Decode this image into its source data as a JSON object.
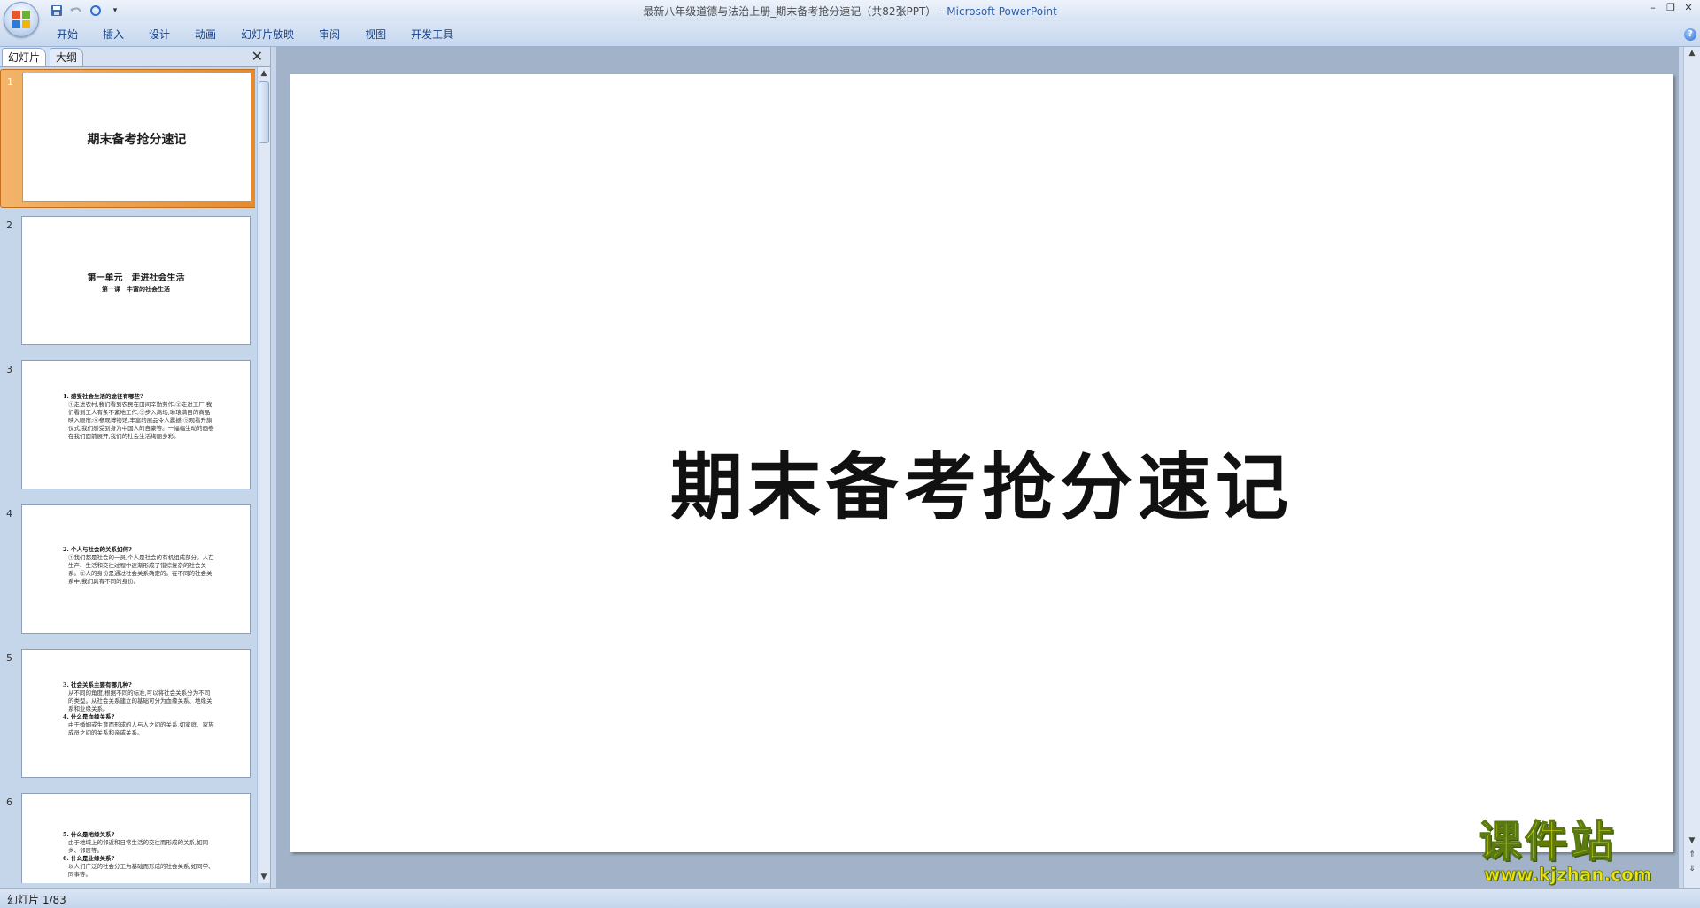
{
  "window": {
    "title": "最新八年级道德与法治上册_期末备考抢分速记（共82张PPT）",
    "app_name": "Microsoft PowerPoint",
    "controls": [
      "–",
      "❐",
      "✕"
    ]
  },
  "quick_access": {
    "save": "save-icon",
    "undo": "undo-icon",
    "redo": "redo-icon",
    "customize": "▾"
  },
  "ribbon": {
    "tabs": [
      "开始",
      "插入",
      "设计",
      "动画",
      "幻灯片放映",
      "审阅",
      "视图",
      "开发工具"
    ],
    "help": "?"
  },
  "pane": {
    "tab_slides": "幻灯片",
    "tab_outline": "大纲",
    "close": "✕"
  },
  "thumbnails": [
    {
      "num": "1",
      "title": "期末备考抢分速记"
    },
    {
      "num": "2",
      "title": "第一单元　走进社会生活",
      "subtitle": "第一课　丰富的社会生活"
    },
    {
      "num": "3",
      "lines": [
        "1. 感受社会生活的途径有哪些?",
        "①走进农村,我们看到农民在田间辛勤劳作;②走进工厂,我们看到工人有条不紊地工作;③步入商场,琳琅满目的商品映入眼帘;④参观博物馆,丰富的展品令人震撼;⑤观看升旗仪式,我们感受到身为中国人的自豪等。一幅幅生动的画卷在我们面前展开,我们的社会生活绚丽多彩。"
      ]
    },
    {
      "num": "4",
      "lines": [
        "2. 个人与社会的关系如何?",
        "①我们都是社会的一员,个人是社会的有机组成部分。人在生产、生活和交往过程中逐渐形成了错综复杂的社会关系。②人的身份是通过社会关系确定的。在不同的社会关系中,我们具有不同的身份。"
      ]
    },
    {
      "num": "5",
      "lines": [
        "3. 社会关系主要有哪几种?",
        "从不同的角度,根据不同的标准,可以将社会关系分为不同的类型。从社会关系建立的基础可分为血缘关系、地缘关系和业缘关系。",
        "4. 什么是血缘关系?",
        "由于婚姻或生育而形成的人与人之间的关系,如家庭、家族成员之间的关系和亲戚关系。"
      ]
    },
    {
      "num": "6",
      "lines": [
        "5. 什么是地缘关系?",
        "由于地域上的邻近和日常生活的交往而形成的关系,如同乡、邻居等。",
        "6. 什么是业缘关系?",
        "以人们广泛的社会分工为基础而形成的社会关系,如同学、同事等。"
      ]
    }
  ],
  "slide": {
    "title": "期末备考抢分速记"
  },
  "watermark": {
    "top": "课件站",
    "bottom": "www.kjzhan.com"
  },
  "status": {
    "text": "幻灯片 1/83"
  }
}
